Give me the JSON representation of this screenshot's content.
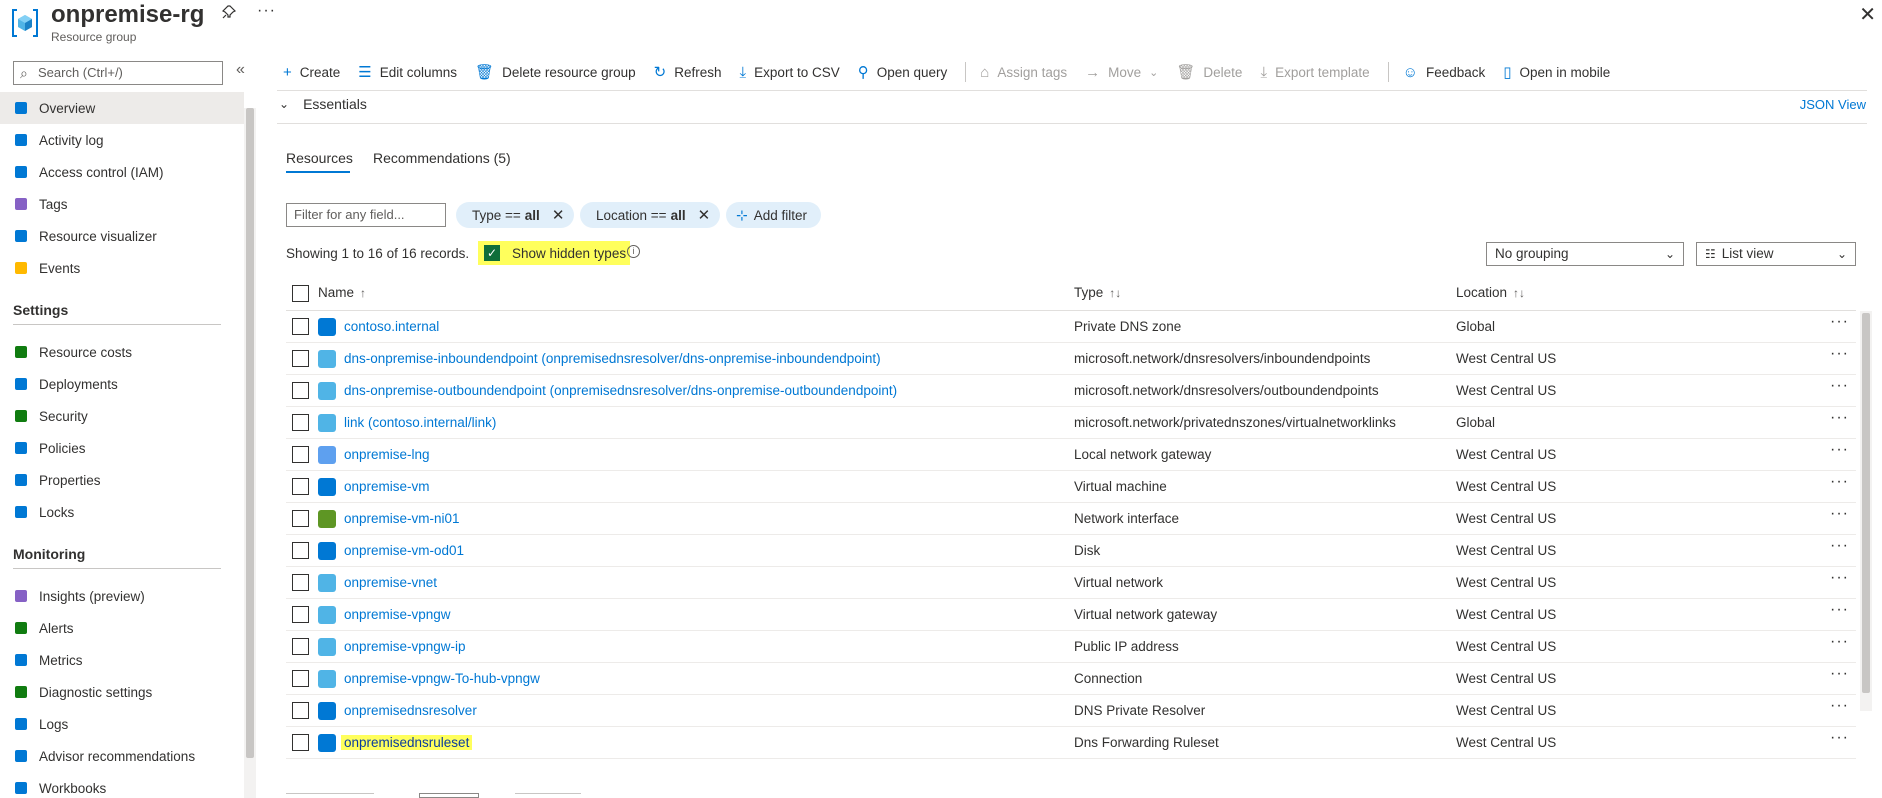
{
  "header": {
    "title": "onpremise-rg",
    "subtitle": "Resource group",
    "more": "···",
    "close": "✕"
  },
  "sidebar": {
    "search_placeholder": "Search (Ctrl+/)",
    "collapse": "«",
    "items": [
      {
        "label": "Overview",
        "icon": "overview-icon",
        "color": "#0078d4",
        "active": true
      },
      {
        "label": "Activity log",
        "icon": "activity-log-icon",
        "color": "#0078d4"
      },
      {
        "label": "Access control (IAM)",
        "icon": "iam-icon",
        "color": "#0078d4"
      },
      {
        "label": "Tags",
        "icon": "tag-icon",
        "color": "#8661c5"
      },
      {
        "label": "Resource visualizer",
        "icon": "visualizer-icon",
        "color": "#0078d4"
      },
      {
        "label": "Events",
        "icon": "events-icon",
        "color": "#ffb900"
      }
    ],
    "settings_title": "Settings",
    "settings": [
      {
        "label": "Resource costs",
        "icon": "cost-icon",
        "color": "#107c10"
      },
      {
        "label": "Deployments",
        "icon": "deploy-icon",
        "color": "#0078d4"
      },
      {
        "label": "Security",
        "icon": "security-icon",
        "color": "#107c10"
      },
      {
        "label": "Policies",
        "icon": "policy-icon",
        "color": "#0078d4"
      },
      {
        "label": "Properties",
        "icon": "properties-icon",
        "color": "#0078d4"
      },
      {
        "label": "Locks",
        "icon": "lock-icon",
        "color": "#0078d4"
      }
    ],
    "monitoring_title": "Monitoring",
    "monitoring": [
      {
        "label": "Insights (preview)",
        "icon": "insights-icon",
        "color": "#8661c5"
      },
      {
        "label": "Alerts",
        "icon": "alerts-icon",
        "color": "#107c10"
      },
      {
        "label": "Metrics",
        "icon": "metrics-icon",
        "color": "#0078d4"
      },
      {
        "label": "Diagnostic settings",
        "icon": "diagnostic-icon",
        "color": "#107c10"
      },
      {
        "label": "Logs",
        "icon": "logs-icon",
        "color": "#0078d4"
      },
      {
        "label": "Advisor recommendations",
        "icon": "advisor-icon",
        "color": "#0078d4"
      },
      {
        "label": "Workbooks",
        "icon": "workbooks-icon",
        "color": "#0078d4"
      }
    ]
  },
  "toolbar": {
    "create": "Create",
    "edit_columns": "Edit columns",
    "delete_rg": "Delete resource group",
    "refresh": "Refresh",
    "export_csv": "Export to CSV",
    "open_query": "Open query",
    "assign_tags": "Assign tags",
    "move": "Move",
    "delete": "Delete",
    "export_template": "Export template",
    "feedback": "Feedback",
    "open_mobile": "Open in mobile"
  },
  "essentials": {
    "label": "Essentials",
    "json_view": "JSON View"
  },
  "tabs": {
    "resources": "Resources",
    "recommendations": "Recommendations (5)"
  },
  "filters": {
    "placeholder": "Filter for any field...",
    "type_key": "Type ==",
    "type_val": "all",
    "location_key": "Location ==",
    "location_val": "all",
    "add_filter": "Add filter"
  },
  "records": {
    "showing": "Showing 1 to 16 of 16 records.",
    "show_hidden": "Show hidden types",
    "grouping": "No grouping",
    "view": "List view"
  },
  "table": {
    "headers": {
      "name": "Name",
      "type": "Type",
      "location": "Location"
    },
    "rows": [
      {
        "name": "contoso.internal",
        "type": "Private DNS zone",
        "location": "Global",
        "icon": "dns-zone-icon",
        "color": "#0078d4"
      },
      {
        "name": "dns-onpremise-inboundendpoint (onpremisednsresolver/dns-onpremise-inboundendpoint)",
        "type": "microsoft.network/dnsresolvers/inboundendpoints",
        "location": "West Central US",
        "icon": "cube-icon",
        "color": "#50b4e6"
      },
      {
        "name": "dns-onpremise-outboundendpoint (onpremisednsresolver/dns-onpremise-outboundendpoint)",
        "type": "microsoft.network/dnsresolvers/outboundendpoints",
        "location": "West Central US",
        "icon": "cube-icon",
        "color": "#50b4e6"
      },
      {
        "name": "link (contoso.internal/link)",
        "type": "microsoft.network/privatednszones/virtualnetworklinks",
        "location": "Global",
        "icon": "cube-icon",
        "color": "#50b4e6"
      },
      {
        "name": "onpremise-lng",
        "type": "Local network gateway",
        "location": "West Central US",
        "icon": "gateway-icon",
        "color": "#5ea0ef"
      },
      {
        "name": "onpremise-vm",
        "type": "Virtual machine",
        "location": "West Central US",
        "icon": "vm-icon",
        "color": "#0078d4"
      },
      {
        "name": "onpremise-vm-ni01",
        "type": "Network interface",
        "location": "West Central US",
        "icon": "nic-icon",
        "color": "#5e9624"
      },
      {
        "name": "onpremise-vm-od01",
        "type": "Disk",
        "location": "West Central US",
        "icon": "disk-icon",
        "color": "#0078d4"
      },
      {
        "name": "onpremise-vnet",
        "type": "Virtual network",
        "location": "West Central US",
        "icon": "vnet-icon",
        "color": "#50b4e6"
      },
      {
        "name": "onpremise-vpngw",
        "type": "Virtual network gateway",
        "location": "West Central US",
        "icon": "vpngw-icon",
        "color": "#50b4e6"
      },
      {
        "name": "onpremise-vpngw-ip",
        "type": "Public IP address",
        "location": "West Central US",
        "icon": "pip-icon",
        "color": "#50b4e6"
      },
      {
        "name": "onpremise-vpngw-To-hub-vpngw",
        "type": "Connection",
        "location": "West Central US",
        "icon": "connection-icon",
        "color": "#50b4e6"
      },
      {
        "name": "onpremisednsresolver",
        "type": "DNS Private Resolver",
        "location": "West Central US",
        "icon": "resolver-icon",
        "color": "#0078d4"
      },
      {
        "name": "onpremisednsruleset",
        "type": "Dns Forwarding Ruleset",
        "location": "West Central US",
        "icon": "ruleset-icon",
        "color": "#0078d4",
        "highlight": true
      }
    ]
  }
}
